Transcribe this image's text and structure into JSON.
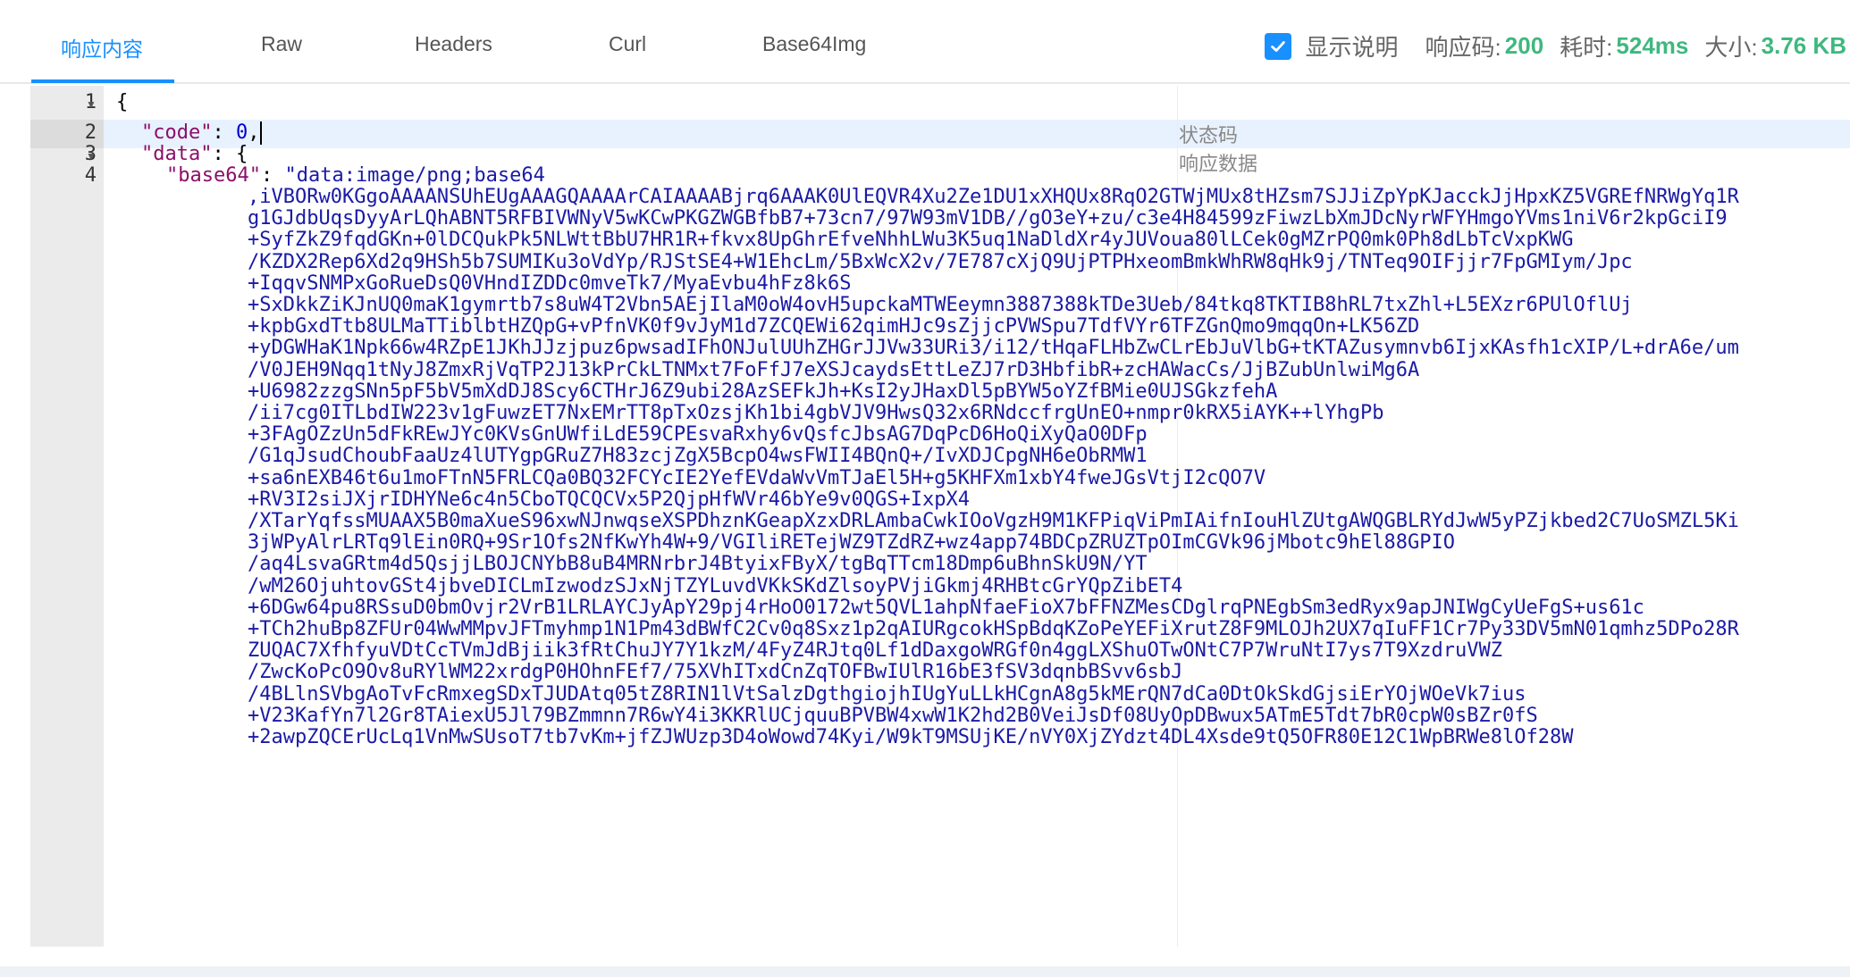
{
  "tabs": [
    {
      "label": "响应内容",
      "active": true
    },
    {
      "label": "Raw",
      "active": false
    },
    {
      "label": "Headers",
      "active": false
    },
    {
      "label": "Curl",
      "active": false
    },
    {
      "label": "Base64Img",
      "active": false
    }
  ],
  "status": {
    "show_desc_label": "显示说明",
    "show_desc_checked": true,
    "code_label": "响应码:",
    "code_value": "200",
    "time_label": "耗时:",
    "time_value": "524ms",
    "size_label": "大小:",
    "size_value": "3.76 KB"
  },
  "editor": {
    "line_numbers": [
      "1",
      "2",
      "3",
      "4"
    ],
    "line1": "{",
    "line2_key": "\"code\"",
    "line2_sep": ": ",
    "line2_value": "0",
    "line2_end": ",",
    "line3_key": "\"data\"",
    "line3_rest": ": {",
    "line4_key": "\"base64\"",
    "line4_sep": ": ",
    "line4_value_start": "\"data:image/png;base64",
    "annotations": {
      "code": "状态码",
      "data": "响应数据"
    },
    "base64_wrapped_lines": [
      ",iVBORw0KGgoAAAANSUhEUgAAAGQAAAArCAIAAAABjrq6AAAK0UlEQVR4Xu2Ze1DU1xXHQUx8RqO2GTWjMUx8tHZsm7SJJiZpYpKJacckJjHpxKZ5VGREfNRWgYq1R",
      "g1GJdbUqsDyyArLQhABNT5RFBIVWNyV5wKCwPKGZWGBfbB7+73cn7/97W93mV1DB//gO3eY+zu/c3e4H84599zFiwzLbXmJDcNyrWFYHmgoYVms1niV6r2kpGciI9",
      "+SyfZkZ9fqdGKn+0lDCQukPk5NLWttBbU7HR1R+fkvx8UpGhrEfveNhhLWu3K5uq1NaDldXr4yJUVoua80lLCek0gMZrPQ0mk0Ph8dLbTcVxpKWG",
      "/KZDX2Rep6Xd2q9HSh5b7SUMIKu3oVdYp/RJStSE4+W1EhcLm/5BxWcX2v/7E787cXjQ9UjPTPHxeomBmkWhRW8qHk9j/TNTeq9OIFjjr7FpGMIym/Jpc",
      "+IqqvSNMPxGoRueDsQ0VHndIZDDc0mveTk7/MyaEvbu4hFz8k6S",
      "+SxDkkZiKJnUQ0maK1gymrtb7s8uW4T2Vbn5AEjIlaM0oW4ovH5upckaMTWEeymn3887388kTDe3Ueb/84tkq8TKTIB8hRL7txZhl+L5EXzr6PUlOflUj",
      "+kpbGxdTtb8ULMaTTiblbtHZQpG+vPfnVK0f9vJyM1d7ZCQEWi62qimHJc9sZjjcPVWSpu7TdfVYr6TFZGnQmo9mqqOn+LK56ZD",
      "+yDGWHaK1Npk66w4RZpE1JKhJJzjpuz6pwsadIFhONJulUUhZHGrJJVw33URi3/i12/tHqaFLHbZwCLrEbJuVlbG+tKTAZusymnvb6IjxKAsfh1cXIP/L+drA6e/um",
      "/V0JEH9Nqq1tNyJ8ZmxRjVqTP2J13kPrCkLTNMxt7FoFfJ7eXSJcaydsEttLeZJ7rD3HbfibR+zcHAWacCs/JjBZubUnlwiMg6A",
      "+U6982zzgSNn5pF5bV5mXdDJ8Scy6CTHrJ6Z9ubi28AzSEFkJh+KsI2yJHaxDl5pBYW5oYZfBMie0UJSGkzfehA",
      "/ii7cg0ITLbdIW223v1gFuwzET7NxEMrTT8pTxOzsjKh1bi4gbVJV9HwsQ32x6RNdccfrgUnEO+nmpr0kRX5iAYK++lYhgPb",
      "+3FAgOZzUn5dFkREwJYc0KVsGnUWfiLdE59CPEsvaRxhy6vQsfcJbsAG7DqPcD6HoQiXyQaO0DFp",
      "/G1qJsudChoubFaaUz4lUTYgpGRuZ7H83zcjZgX5BcpO4wsFWII4BQnQ+/IvXDJCpgNH6eObRMW1",
      "+sa6nEXB46t6u1moFTnN5FRLCQa0BQ32FCYcIE2YefEVdaWvVmTJaEl5H+g5KHFXm1xbY4fweJGsVtjI2cQO7V",
      "+RV3I2siJXjrIDHYNe6c4n5CboTQCQCVx5P2QjpHfWVr46bYe9v0QGS+IxpX4",
      "/XTarYqfssMUAAX5B0maXueS96xwNJnwqseXSPDhznKGeapXzxDRLAmbaCwkIOoVgzH9M1KFPiqViPmIAifnIouHlZUtgAWQGBLRYdJwW5yPZjkbed2C7UoSMZL5Ki",
      "3jWPyAlrLRTq9lEin0RQ+9Sr1Ofs2NfKwYh4W+9/VGIliRETejWZ9TZdRZ+wz4app74BDCpZRUZTpOImCGVk96jMbotc9hEl88GPIO",
      "/aq4LsvaGRtm4d5QsjjLBOJCNYbB8uB4MRNrbrJ4BtyixFByX/tgBqTTcm18Dmp6uBhnSkU9N/YT",
      "/wM26OjuhtovGSt4jbveDICLmIzwodzSJxNjTZYLuvdVKkSKdZlsoyPVjiGkmj4RHBtcGrYQpZibET4",
      "+6DGw64pu8RSsuD0bmOvjr2VrB1LRLAYCJyApY29pj4rHoO0172wt5QVL1ahpNfaeFioX7bFFNZMesCDglrqPNEgbSm3edRyx9apJNIWgCyUeFgS+us61c",
      "+TCh2huBp8ZFUr04WwMMpvJFTmyhmp1N1Pm43dBWfC2Cv0q8Sxz1p2qAIURgcokHSpBdqKZoPeYEFiXrutZ8F9MLOJh2UX7qIuFF1Cr7Py33DV5mN01qmhz5DPo28R",
      "ZUQAC7XfhfyuVDtCcTVmJdBjiik3fRtChuJY7Y1kzM/4FyZ4RJtq0Lf1dDaxgoWRGf0n4ggLXShuOTwONtC7P7WruNtI7ys7T9XzdruVWZ",
      "/ZwcKoPcO9Ov8uRYlWM22xrdgP0HOhnFEf7/75XVhITxdCnZqTOFBwIUlR16bE3fSV3dqnbBSvv6sbJ",
      "/4BLlnSVbgAoTvFcRmxegSDxTJUDAtq05tZ8RIN1lVtSalzDgthgiojhIUgYuLLkHCgnA8g5kMErQN7dCa0DtOkSkdGjsiErYOjWOeVk7ius",
      "+V23KafYn7l2Gr8TAiexU5Jl79BZmmnn7R6wY4i3KKRlUCjquuBPVBW4xwW1K2hd2B0VeiJsDf08UyOpDBwux5ATmE5Tdt7bR0cpW0sBZr0fS",
      "+2awpZQCErUcLq1VnMwSUsoT7tb7vKm+jfZJWUzp3D4oWowd74Kyi/W9kT9MSUjKE/nVY0XjZYdzt4DL4Xsde9tQ5OFR80E12C1WpBRWe8lOf28W"
    ]
  }
}
